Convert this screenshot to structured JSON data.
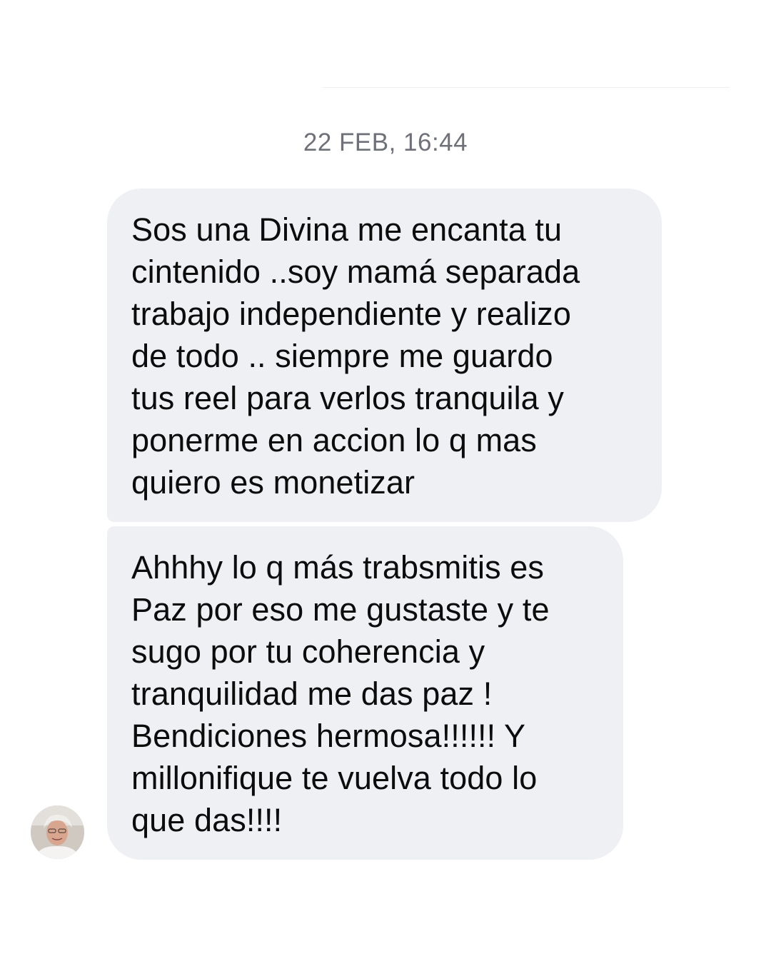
{
  "thread": {
    "timestamp": "22 FEB, 16:44",
    "messages": [
      {
        "text": "Sos una Divina me encanta tu\ncintenido ..soy mamá separada\ntrabajo independiente y realizo\nde todo .. siempre me guardo\ntus reel para verlos tranquila y\nponerme en accion lo q mas\nquiero es monetizar"
      },
      {
        "text": "Ahhhy lo q más trabsmitis es\nPaz por eso me gustaste y te\nsugo por tu coherencia y\ntranquilidad me das paz !\nBendiciones hermosa!!!!!! Y\nmillonifique te vuelva todo lo\nque das!!!!"
      }
    ]
  },
  "sender": {
    "avatar_icon": "profile-photo-avatar"
  },
  "colors": {
    "bubble_background": "#eff0f4",
    "timestamp_text": "#6e7177",
    "message_text": "#0c0c0d"
  }
}
